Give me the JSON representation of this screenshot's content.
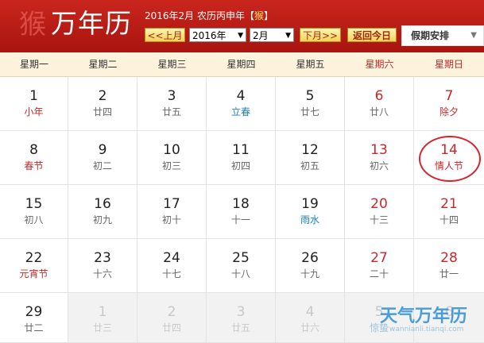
{
  "header": {
    "logo_glyph": "猴",
    "title": "万年历",
    "solar_date": "2016年2月",
    "lunar_text": "农历丙申年【",
    "zodiac": "猴",
    "lunar_close": "】",
    "prev_month": "<<上月",
    "year_value": "2016年",
    "month_value": "2月",
    "next_month": "下月>>",
    "back_today": "返回今日",
    "holiday": "假期安排"
  },
  "weekdays": [
    "星期一",
    "星期二",
    "星期三",
    "星期四",
    "星期五",
    "星期六",
    "星期日"
  ],
  "weeks": [
    [
      {
        "d": "1",
        "l": "小年",
        "t": "fest"
      },
      {
        "d": "2",
        "l": "廿四"
      },
      {
        "d": "3",
        "l": "廿五"
      },
      {
        "d": "4",
        "l": "立春",
        "t": "term"
      },
      {
        "d": "5",
        "l": "廿七"
      },
      {
        "d": "6",
        "l": "廿八"
      },
      {
        "d": "7",
        "l": "除夕",
        "t": "fest"
      }
    ],
    [
      {
        "d": "8",
        "l": "春节",
        "t": "fest"
      },
      {
        "d": "9",
        "l": "初二"
      },
      {
        "d": "10",
        "l": "初三"
      },
      {
        "d": "11",
        "l": "初四"
      },
      {
        "d": "12",
        "l": "初五"
      },
      {
        "d": "13",
        "l": "初六"
      },
      {
        "d": "14",
        "l": "情人节",
        "t": "fest",
        "circled": true
      }
    ],
    [
      {
        "d": "15",
        "l": "初八"
      },
      {
        "d": "16",
        "l": "初九"
      },
      {
        "d": "17",
        "l": "初十"
      },
      {
        "d": "18",
        "l": "十一"
      },
      {
        "d": "19",
        "l": "雨水",
        "t": "term"
      },
      {
        "d": "20",
        "l": "十三"
      },
      {
        "d": "21",
        "l": "十四"
      }
    ],
    [
      {
        "d": "22",
        "l": "元宵节",
        "t": "fest"
      },
      {
        "d": "23",
        "l": "十六"
      },
      {
        "d": "24",
        "l": "十七"
      },
      {
        "d": "25",
        "l": "十八"
      },
      {
        "d": "26",
        "l": "十九"
      },
      {
        "d": "27",
        "l": "二十"
      },
      {
        "d": "28",
        "l": "廿一"
      }
    ],
    [
      {
        "d": "29",
        "l": "廿二"
      },
      {
        "d": "1",
        "l": "廿三",
        "other": true
      },
      {
        "d": "2",
        "l": "廿四",
        "other": true
      },
      {
        "d": "3",
        "l": "廿五",
        "other": true
      },
      {
        "d": "4",
        "l": "廿六",
        "other": true
      },
      {
        "d": "5",
        "l": "惊蛰",
        "t": "term",
        "other": true
      },
      {
        "d": "6",
        "l": "",
        "other": true
      }
    ]
  ],
  "watermark": {
    "title": "天气万年历",
    "url": "wannianli.tianqi.com"
  },
  "colors": {
    "header_red": "#b81a14",
    "weekend_red": "#c8282a",
    "solar_term_blue": "#1a7fc0"
  }
}
